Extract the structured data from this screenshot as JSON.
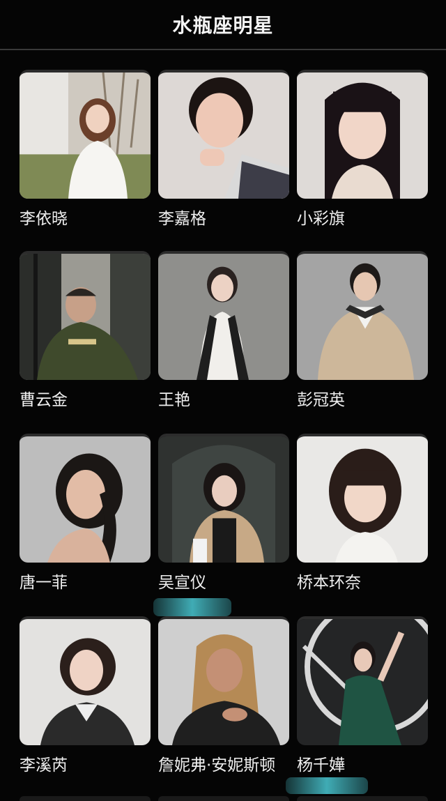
{
  "header": {
    "title": "水瓶座明星"
  },
  "celebrities": [
    {
      "name": "李依晓"
    },
    {
      "name": "李嘉格"
    },
    {
      "name": "小彩旗"
    },
    {
      "name": "曹云金"
    },
    {
      "name": "王艳"
    },
    {
      "name": "彭冠英"
    },
    {
      "name": "唐一菲"
    },
    {
      "name": "吴宣仪"
    },
    {
      "name": "桥本环奈"
    },
    {
      "name": "李溪芮"
    },
    {
      "name": "詹妮弗·安妮斯顿"
    },
    {
      "name": "杨千嬅"
    }
  ],
  "colors": {
    "background": "#050505",
    "text": "#efefef",
    "divider": "#3a3a3a",
    "highlight_smudge": "#46bec8"
  }
}
